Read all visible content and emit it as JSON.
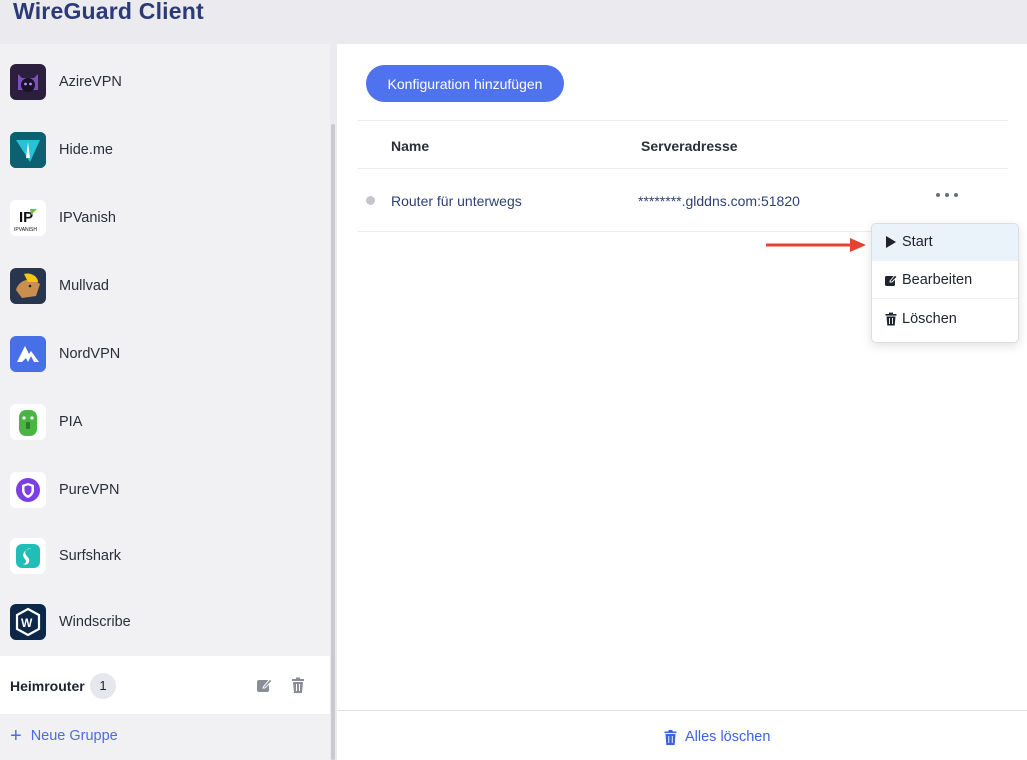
{
  "app": {
    "title": "WireGuard Client"
  },
  "sidebar": {
    "providers": [
      {
        "label": "AzireVPN",
        "icon": "azirevpn-logo-icon",
        "color": "#2b1f3d"
      },
      {
        "label": "Hide.me",
        "icon": "hideme-logo-icon",
        "color": "#0f6f7a"
      },
      {
        "label": "IPVanish",
        "icon": "ipvanish-logo-icon",
        "color": "#ffffff",
        "logo_text": "IPVANISH"
      },
      {
        "label": "Mullvad",
        "icon": "mullvad-logo-icon",
        "color": "#28354f"
      },
      {
        "label": "NordVPN",
        "icon": "nordvpn-logo-icon",
        "color": "#4770e6"
      },
      {
        "label": "PIA",
        "icon": "pia-logo-icon",
        "color": "#ffffff"
      },
      {
        "label": "PureVPN",
        "icon": "purevpn-logo-icon",
        "color": "#ffffff"
      },
      {
        "label": "Surfshark",
        "icon": "surfshark-logo-icon",
        "color": "#ffffff"
      },
      {
        "label": "Windscribe",
        "icon": "windscribe-logo-icon",
        "color": "#0c2747"
      }
    ],
    "group": {
      "name": "Heimrouter",
      "count": "1"
    },
    "new_group_label": "Neue Gruppe"
  },
  "main": {
    "add_button_label": "Konfiguration hinzufügen",
    "columns": {
      "name": "Name",
      "address": "Serveradresse"
    },
    "rows": [
      {
        "name": "Router für unterwegs",
        "address": "********.glddns.com:51820",
        "status": "inactive"
      }
    ],
    "context_menu": {
      "items": [
        {
          "label": "Start",
          "icon": "play-icon",
          "highlighted": true
        },
        {
          "label": "Bearbeiten",
          "icon": "edit-icon",
          "highlighted": false
        },
        {
          "label": "Löschen",
          "icon": "trash-icon",
          "highlighted": false
        }
      ]
    },
    "footer": {
      "clear_all_label": "Alles löschen"
    }
  },
  "colors": {
    "accent": "#4f72ee",
    "title": "#2c3a76",
    "link": "#3d62e0",
    "arrow": "#e2442f"
  }
}
